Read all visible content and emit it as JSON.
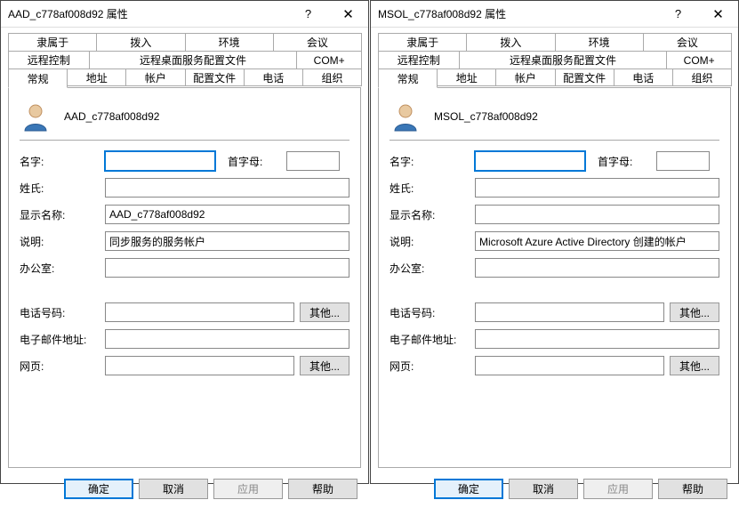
{
  "dialogs": [
    {
      "title": "AAD_c778af008d92 属性",
      "username": "AAD_c778af008d92",
      "fields": {
        "firstname_label": "名字:",
        "firstname_value": "",
        "initials_label": "首字母:",
        "initials_value": "",
        "lastname_label": "姓氏:",
        "lastname_value": "",
        "displayname_label": "显示名称:",
        "displayname_value": "AAD_c778af008d92",
        "description_label": "说明:",
        "description_value": "同步服务的服务帐户",
        "office_label": "办公室:",
        "office_value": "",
        "phone_label": "电话号码:",
        "phone_value": "",
        "email_label": "电子邮件地址:",
        "email_value": "",
        "web_label": "网页:",
        "web_value": ""
      }
    },
    {
      "title": "MSOL_c778af008d92 属性",
      "username": "MSOL_c778af008d92",
      "fields": {
        "firstname_label": "名字:",
        "firstname_value": "",
        "initials_label": "首字母:",
        "initials_value": "",
        "lastname_label": "姓氏:",
        "lastname_value": "",
        "displayname_label": "显示名称:",
        "displayname_value": "",
        "description_label": "说明:",
        "description_value": "Microsoft Azure Active Directory 创建的帐户",
        "office_label": "办公室:",
        "office_value": "",
        "phone_label": "电话号码:",
        "phone_value": "",
        "email_label": "电子邮件地址:",
        "email_value": "",
        "web_label": "网页:",
        "web_value": ""
      }
    }
  ],
  "tabs": {
    "row1": [
      "隶属于",
      "拨入",
      "环境",
      "会议"
    ],
    "row2": [
      "远程控制",
      "远程桌面服务配置文件",
      "COM+"
    ],
    "row3": [
      "常规",
      "地址",
      "帐户",
      "配置文件",
      "电话",
      "组织"
    ]
  },
  "buttons": {
    "other": "其他...",
    "ok": "确定",
    "cancel": "取消",
    "apply": "应用",
    "help": "帮助",
    "question": "?",
    "close": "✕"
  }
}
